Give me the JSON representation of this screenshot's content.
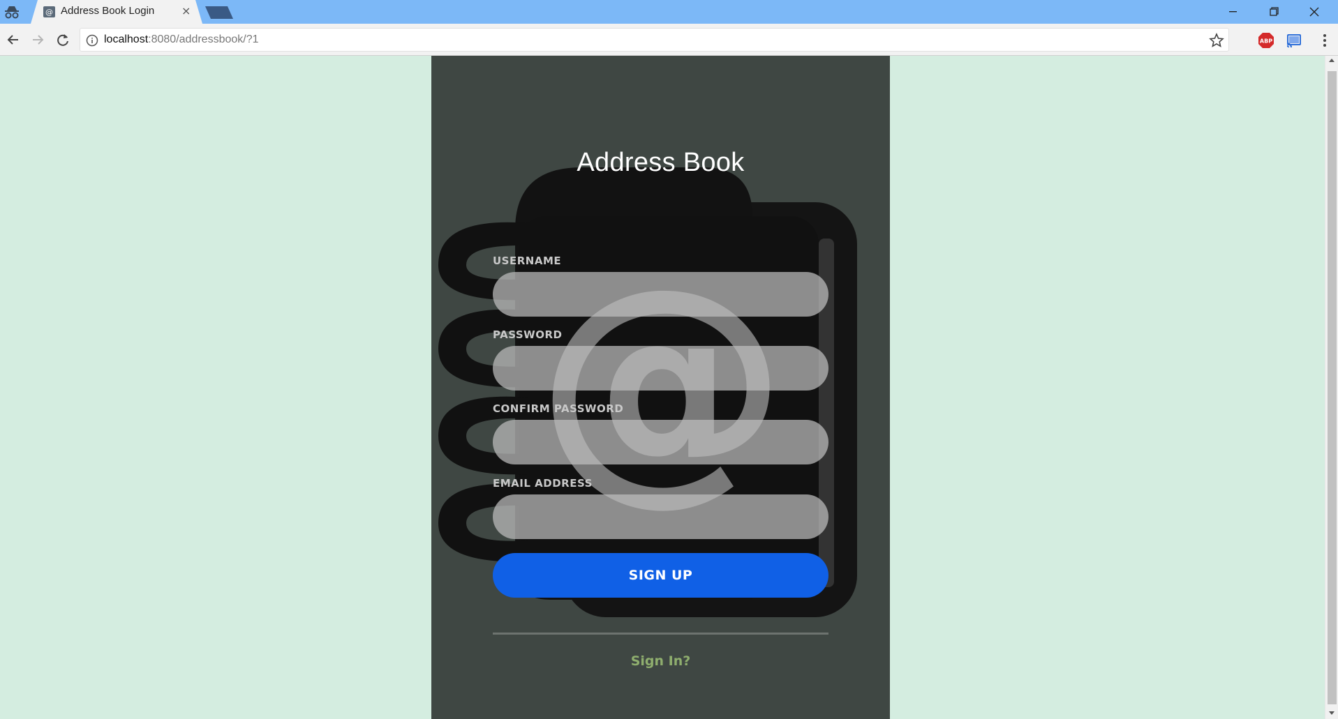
{
  "browser": {
    "tab_title": "Address Book Login",
    "tab_close": "×",
    "url_host": "localhost",
    "url_rest": ":8080/addressbook/?1",
    "icons": [
      "incognito-icon",
      "favicon-icon",
      "back-icon",
      "forward-icon",
      "reload-icon",
      "info-icon",
      "star-icon",
      "adblock-icon",
      "cast-icon",
      "menu-icon",
      "minimize-icon",
      "maximize-icon",
      "close-icon"
    ]
  },
  "app": {
    "title": "Address Book",
    "fields": {
      "username_label": "USERNAME",
      "username_value": "",
      "password_label": "PASSWORD",
      "password_value": "",
      "confirm_label": "CONFIRM PASSWORD",
      "confirm_value": "",
      "email_label": "EMAIL ADDRESS",
      "email_value": ""
    },
    "signup_label": "SIGN UP",
    "signin_label": "Sign In?",
    "background_icon": "address-book-at-icon",
    "colors": {
      "page_bg": "#d4ede0",
      "panel_bg": "#3f4743",
      "button": "#1060e6",
      "link": "#8fae6e"
    }
  }
}
